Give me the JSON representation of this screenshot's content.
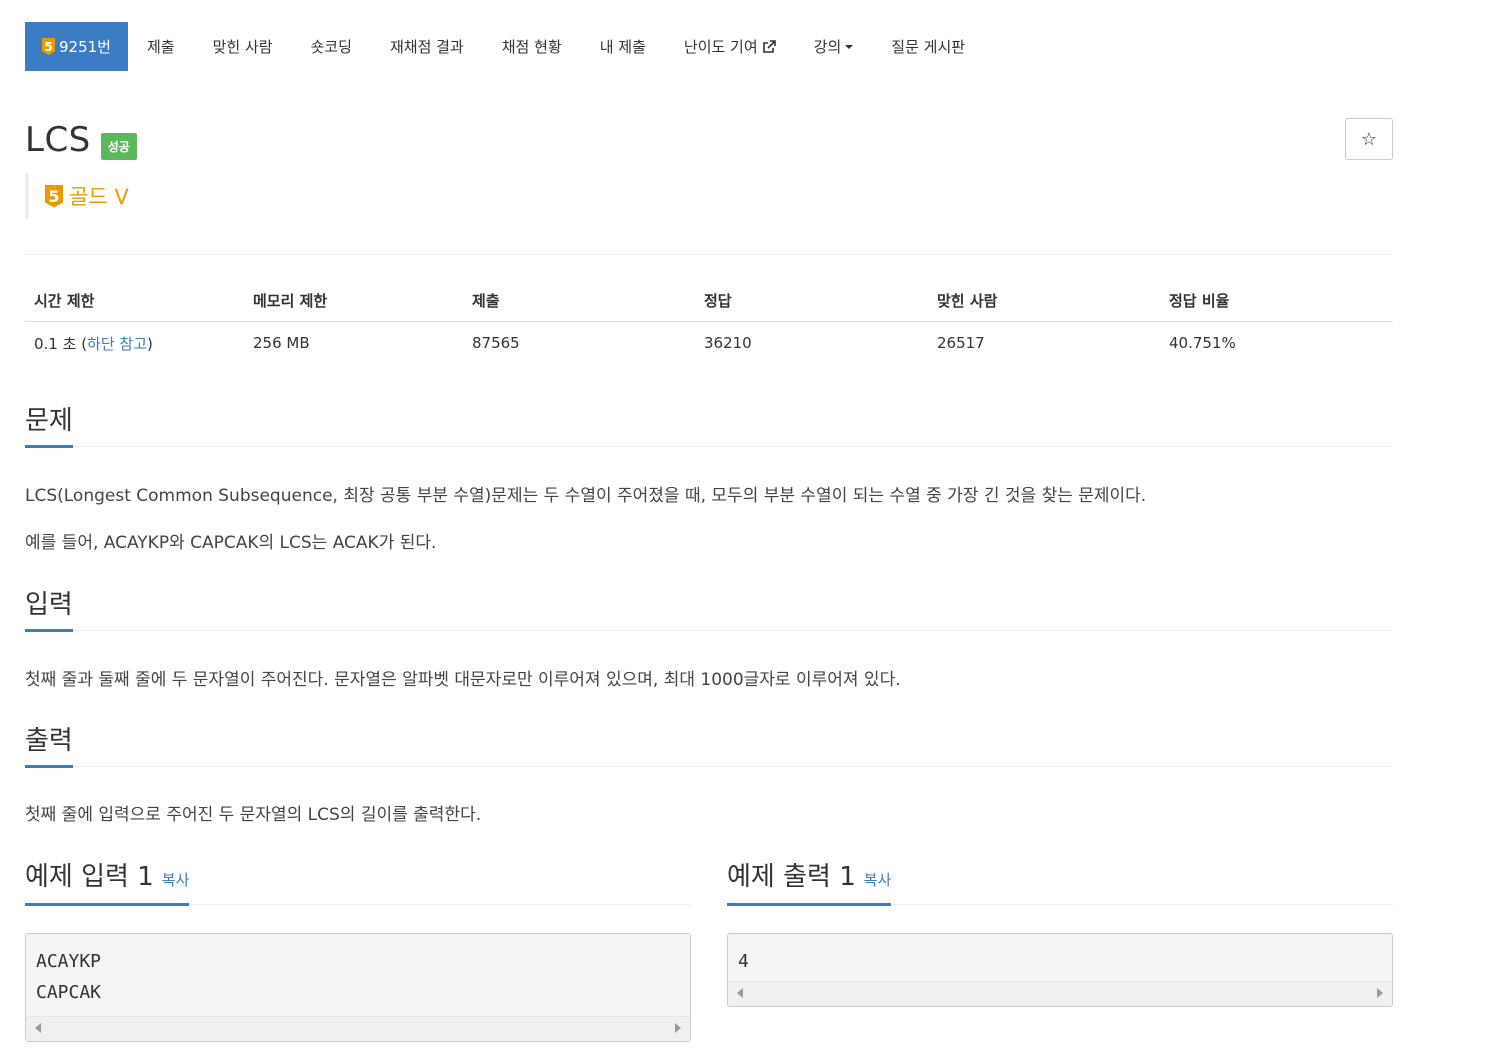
{
  "nav": {
    "problem_tier": "5",
    "problem_number": "9251번",
    "items": [
      "제출",
      "맞힌 사람",
      "숏코딩",
      "재채점 결과",
      "채점 현황",
      "내 제출",
      "난이도 기여",
      "강의",
      "질문 게시판"
    ]
  },
  "problem": {
    "title": "LCS",
    "status_badge": "성공",
    "tier_number": "5",
    "tier_label": "골드 V",
    "star": "☆"
  },
  "info_table": {
    "headers": [
      "시간 제한",
      "메모리 제한",
      "제출",
      "정답",
      "맞힌 사람",
      "정답 비율"
    ],
    "time_prefix": "0.1 초 (",
    "time_link": "하단 참고",
    "time_suffix": ")",
    "memory": "256 MB",
    "submissions": "87565",
    "accepted": "36210",
    "solved_users": "26517",
    "ratio": "40.751%"
  },
  "sections": {
    "problem_title": "문제",
    "problem_p1": "LCS(Longest Common Subsequence, 최장 공통 부분 수열)문제는 두 수열이 주어졌을 때, 모두의 부분 수열이 되는 수열 중 가장 긴 것을 찾는 문제이다.",
    "problem_p2": "예를 들어, ACAYKP와 CAPCAK의 LCS는 ACAK가 된다.",
    "input_title": "입력",
    "input_p": "첫째 줄과 둘째 줄에 두 문자열이 주어진다. 문자열은 알파벳 대문자로만 이루어져 있으며, 최대 1000글자로 이루어져 있다.",
    "output_title": "출력",
    "output_p": "첫째 줄에 입력으로 주어진 두 문자열의 LCS의 길이를 출력한다."
  },
  "samples": {
    "input_title": "예제 입력 1",
    "output_title": "예제 출력 1",
    "copy_label": "복사",
    "input_lines": [
      "ACAYKP",
      "CAPCAK"
    ],
    "output_lines": [
      "4"
    ]
  },
  "colors": {
    "accent": "#3b7dc4",
    "tier_gold": "#ec9a00",
    "success": "#5cb85c"
  }
}
